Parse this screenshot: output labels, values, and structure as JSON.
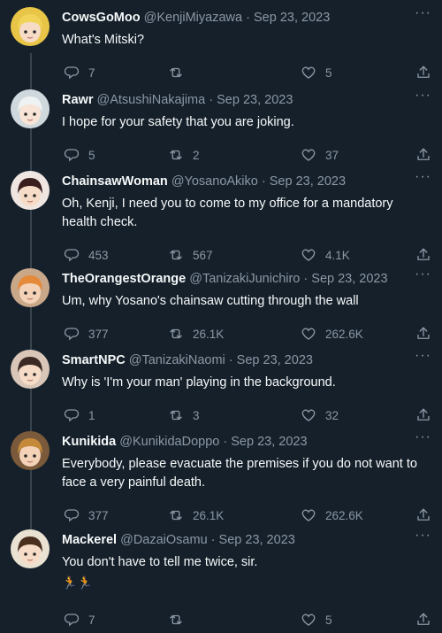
{
  "tweets": [
    {
      "name": "CowsGoMoo",
      "handle": "@KenjiMiyazawa",
      "date": "Sep 23, 2023",
      "text": "What's Mitski?",
      "replies": "7",
      "retweets": "",
      "likes": "5",
      "avatar_color": "#e8c547",
      "avatar_hair": "#f2d35a",
      "avatar_skin": "#f6dcc6"
    },
    {
      "name": "Rawr",
      "handle": "@AtsushiNakajima",
      "date": "Sep 23, 2023",
      "text": "I hope for your safety that you are joking.",
      "replies": "5",
      "retweets": "2",
      "likes": "37",
      "avatar_color": "#cfd8dc",
      "avatar_hair": "#eef2f3",
      "avatar_skin": "#f7e4d6"
    },
    {
      "name": "ChainsawWoman",
      "handle": "@YosanoAkiko",
      "date": "Sep 23, 2023",
      "text": "Oh, Kenji, I need you to come to my office for a mandatory health check.",
      "replies": "453",
      "retweets": "567",
      "likes": "4.1K",
      "avatar_color": "#efe6e2",
      "avatar_hair": "#3a1e1e",
      "avatar_skin": "#f6dcc6"
    },
    {
      "name": "TheOrangestOrange",
      "handle": "@TanizakiJunichiro",
      "date": "Sep 23, 2023",
      "text": "Um, why Yosano's chainsaw cutting through the wall",
      "replies": "377",
      "retweets": "26.1K",
      "likes": "262.6K",
      "avatar_color": "#c9a88a",
      "avatar_hair": "#e58a3a",
      "avatar_skin": "#f3d2b8"
    },
    {
      "name": "SmartNPC",
      "handle": "@TanizakiNaomi",
      "date": "Sep 23, 2023",
      "text": "Why is 'I'm your man' playing in the background.",
      "replies": "1",
      "retweets": "3",
      "likes": "32",
      "avatar_color": "#d9c6b8",
      "avatar_hair": "#3b2a24",
      "avatar_skin": "#f6dcc6"
    },
    {
      "name": "Kunikida",
      "handle": "@KunikidaDoppo",
      "date": "Sep 23, 2023",
      "text": "Everybody, please evacuate the premises if you do not want to face a very painful death.",
      "replies": "377",
      "retweets": "26.1K",
      "likes": "262.6K",
      "avatar_color": "#7a5a3a",
      "avatar_hair": "#c48a3a",
      "avatar_skin": "#f3d2b8"
    },
    {
      "name": "Mackerel",
      "handle": "@DazaiOsamu",
      "date": "Sep 23, 2023",
      "text": "You don't have to tell me twice, sir.",
      "emoji": "🏃🏃",
      "replies": "7",
      "retweets": "",
      "likes": "5",
      "avatar_color": "#e9e2d2",
      "avatar_hair": "#4a2e1e",
      "avatar_skin": "#f6dcc6"
    }
  ],
  "icons": {
    "reply": "reply-icon",
    "retweet": "retweet-icon",
    "like": "heart-icon",
    "share": "share-icon",
    "more": "more-icon"
  },
  "dot": "·",
  "more_glyph": "···"
}
